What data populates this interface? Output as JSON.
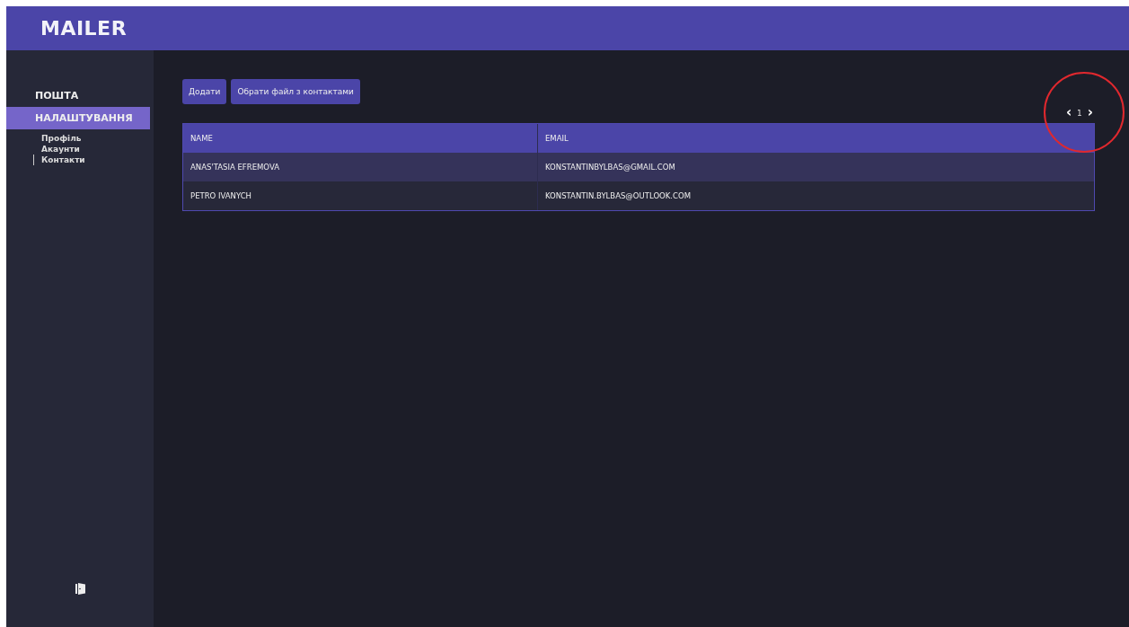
{
  "app": {
    "title": "MAILER"
  },
  "sidebar": {
    "items": [
      {
        "label": "ПОШТА",
        "selected": false
      },
      {
        "label": "НАЛАШТУВАННЯ",
        "selected": true,
        "children": [
          {
            "label": "Профіль",
            "selected": false
          },
          {
            "label": "Акаунти",
            "selected": false
          },
          {
            "label": "Контакти",
            "selected": true
          }
        ]
      }
    ]
  },
  "toolbar": {
    "buttons": [
      "Додати",
      "Обрати файл з контактами"
    ]
  },
  "pagination": {
    "prev": "‹",
    "page": "1",
    "next": "›"
  },
  "table": {
    "columns": [
      "NAME",
      "EMAIL"
    ],
    "rows": [
      {
        "cells": [
          "ANAS'TASIA EFREMOVA",
          "KONSTANTINBYLBAS@GMAIL.COM"
        ]
      },
      {
        "cells": [
          "PETRO IVANYCH",
          "KONSTANTIN.BYLBAS@OUTLOOK.COM"
        ]
      }
    ]
  },
  "annotation": {
    "kind": "circle"
  }
}
